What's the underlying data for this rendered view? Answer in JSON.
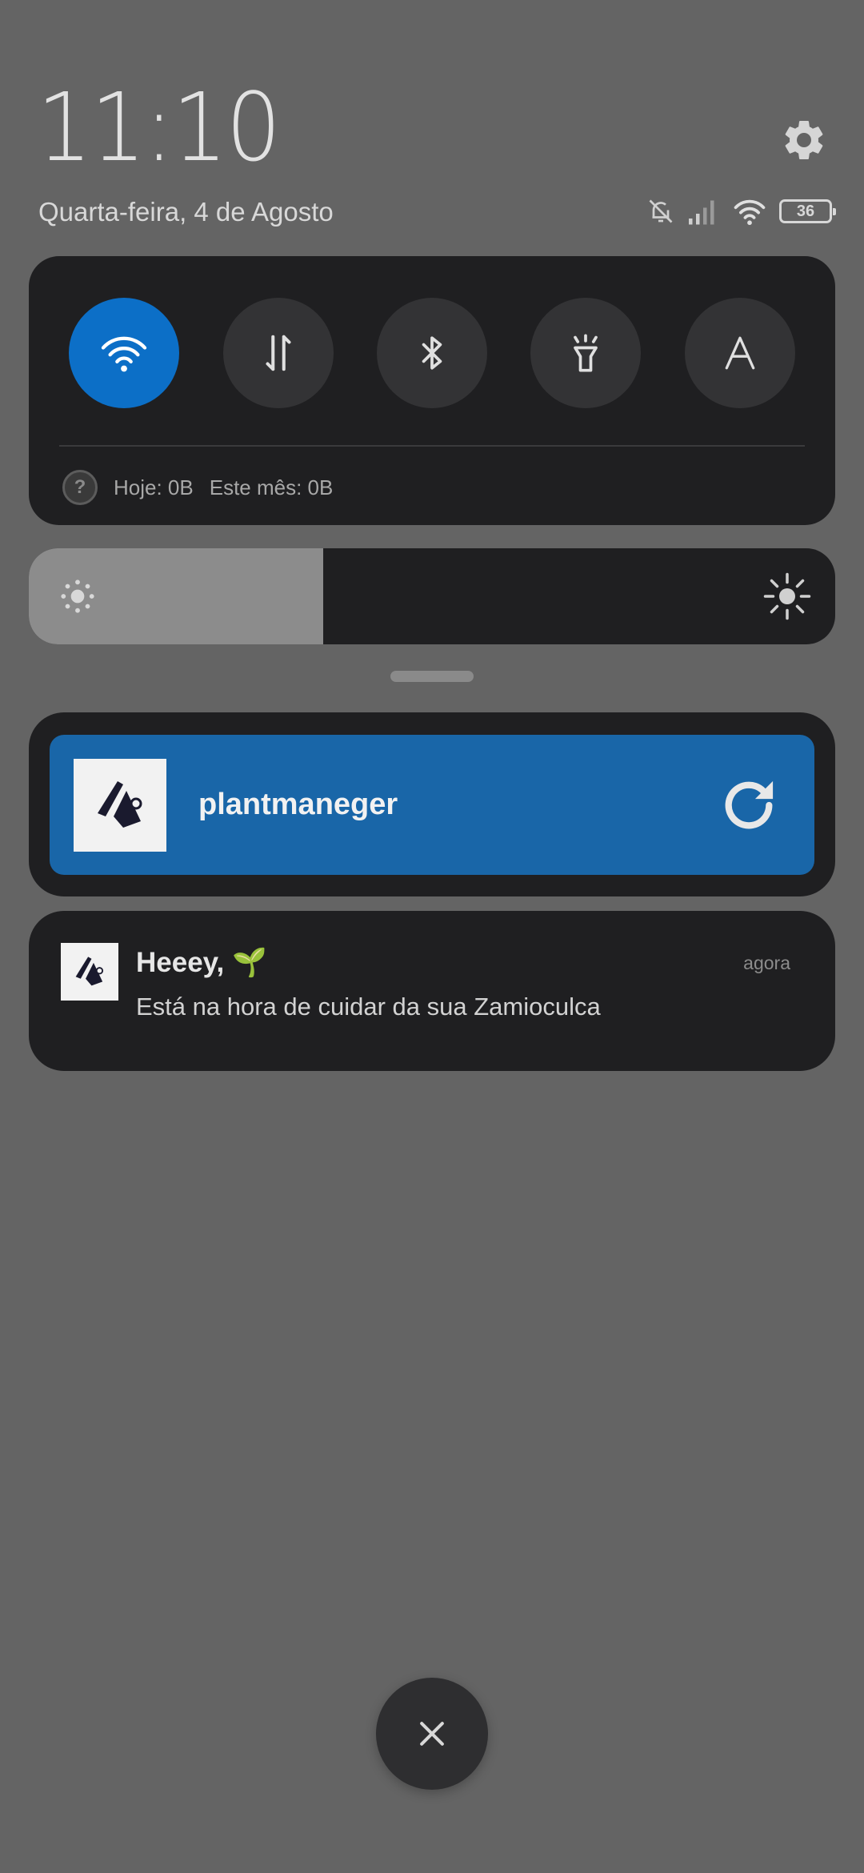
{
  "header": {
    "time": "11:10",
    "date": "Quarta-feira, 4 de Agosto",
    "battery_level": "36",
    "icons": [
      "settings-gear-icon",
      "bell-muted-icon",
      "signal-icon",
      "wifi-icon",
      "battery-icon"
    ]
  },
  "quick_settings": {
    "toggles": [
      {
        "name": "wifi",
        "icon": "wifi-icon",
        "active": true
      },
      {
        "name": "mobile-data",
        "icon": "data-arrows-icon",
        "active": false
      },
      {
        "name": "bluetooth",
        "icon": "bluetooth-icon",
        "active": false
      },
      {
        "name": "flashlight",
        "icon": "flashlight-icon",
        "active": false
      },
      {
        "name": "auto-brightness",
        "icon": "letter-a-icon",
        "active": false
      }
    ],
    "data_today": "Hoje: 0B",
    "data_month": "Este mês: 0B",
    "help_symbol": "?"
  },
  "brightness": {
    "level_fraction": 0.365
  },
  "media_notification": {
    "app_name": "plantmaneger",
    "accent_color": "#1966a8"
  },
  "notification": {
    "title": "Heeey, 🌱",
    "time": "agora",
    "body": "Está na hora de cuidar da sua Zamioculca"
  },
  "colors": {
    "background": "#646464",
    "panel": "#1f1f21",
    "active_toggle": "#0c6fc7"
  }
}
